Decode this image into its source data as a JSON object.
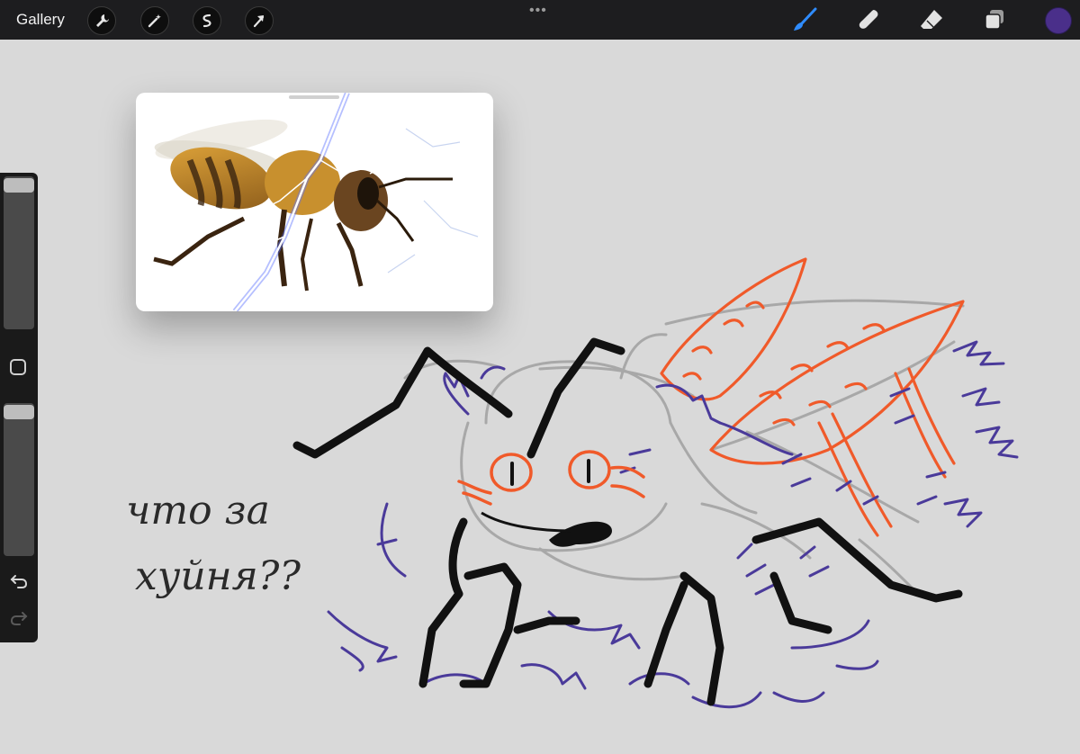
{
  "topbar": {
    "gallery_label": "Gallery",
    "left_tools": [
      "wrench-icon",
      "magic-wand-icon",
      "selection-icon",
      "transform-arrow-icon"
    ],
    "menu_dots": "•••",
    "right_tools": [
      "brush-icon",
      "smudge-icon",
      "eraser-icon",
      "layers-icon"
    ],
    "active_tool": "brush-icon",
    "active_color": "#4a2f8a",
    "accent_color": "#2f8cff"
  },
  "sidebar": {
    "brush_size_slider": "slider",
    "modify_button": "square-icon",
    "opacity_slider": "slider",
    "undo": "undo-icon",
    "redo": "redo-icon"
  },
  "reference": {
    "image": "honeybee-with-lightning-photo"
  },
  "canvas": {
    "handwritten_text_line1": "что за",
    "handwritten_text_line2": "хуйня??",
    "drawing": "sketched-bee-character",
    "colors": {
      "outline_black": "#111111",
      "fur_purple": "#4a3a9a",
      "wing_red": "#f05a2a",
      "sketch_gray": "#a9a9a9"
    }
  }
}
